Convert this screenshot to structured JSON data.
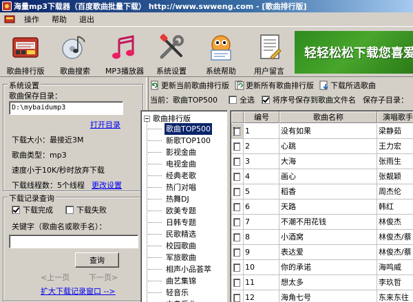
{
  "window": {
    "title": "海量mp3下载器（百度歌曲批量下载） http://www.swweng.com - [歌曲排行版]"
  },
  "menu": {
    "items": [
      "操作",
      "帮助",
      "退出"
    ]
  },
  "toolbar": {
    "buttons": [
      {
        "label": "歌曲排行版",
        "icon": "ranking-icon"
      },
      {
        "label": "歌曲搜索",
        "icon": "music-search-icon"
      },
      {
        "label": "MP3播放器",
        "icon": "music-notes-icon"
      },
      {
        "label": "系统设置",
        "icon": "tools-icon"
      },
      {
        "label": "系统帮助",
        "icon": "help-mascot-icon"
      },
      {
        "label": "用户留言",
        "icon": "document-icon"
      }
    ],
    "banner": "轻轻松松下载您喜爱"
  },
  "settings": {
    "legend": "系统设置",
    "save_dir_label": "歌曲保存目录：",
    "save_dir_value": "D:\\mybaidump3",
    "open_dir_link": "打开目录",
    "size_label": "下载大小：最接近3M",
    "type_label": "歌曲类型：mp3",
    "speed_label": "速度小于10K/秒时放弃下载",
    "threads_label": "下载线程数：5个线程",
    "change_settings_link": "更改设置"
  },
  "history": {
    "legend": "下载记录查询",
    "success_label": "下载完成",
    "success_checked": true,
    "failed_label": "下载失败",
    "failed_checked": false,
    "keyword_label": "关键字（歌曲名或歌手名）：",
    "keyword_value": "",
    "query_button": "查询",
    "prev_link": "<上一页",
    "next_link": "下一页>",
    "expand_link": "扩大下载记录窗口 -->"
  },
  "actions": {
    "update_current": "更新当前歌曲排行版",
    "update_all": "更新所有歌曲排行版",
    "download_selected": "下载所选歌曲"
  },
  "options": {
    "current_label": "当前：歌曲TOP500",
    "select_all_label": "全选",
    "select_all_checked": false,
    "save_by_index_label": "将序号保存到歌曲文件名",
    "save_by_index_checked": true,
    "save_subdir_label": "保存子目录："
  },
  "tree": {
    "root": "歌曲排行版",
    "selected_index": 0,
    "nodes": [
      "歌曲TOP500",
      "新歌TOP100",
      "影视金曲",
      "电视金曲",
      "经典老歌",
      "热门对唱",
      "热舞DJ",
      "欧美专题",
      "日韩专题",
      "民歌精选",
      "校园歌曲",
      "军旅歌曲",
      "相声小品荟萃",
      "曲艺集锦",
      "轻音乐",
      "古典乐曲"
    ]
  },
  "table": {
    "columns": [
      "",
      "编号",
      "歌曲名称",
      "演唱歌手"
    ],
    "rows": [
      {
        "num": "1",
        "song": "没有如果",
        "artist": "梁静茹",
        "checked": false
      },
      {
        "num": "2",
        "song": "心跳",
        "artist": "王力宏",
        "checked": false
      },
      {
        "num": "3",
        "song": "大海",
        "artist": "张雨生",
        "checked": false
      },
      {
        "num": "4",
        "song": "画心",
        "artist": "张靓颖",
        "checked": false
      },
      {
        "num": "5",
        "song": "稻香",
        "artist": "周杰伦",
        "checked": false
      },
      {
        "num": "6",
        "song": "天路",
        "artist": "韩红",
        "checked": false
      },
      {
        "num": "7",
        "song": "不潮不用花钱",
        "artist": "林俊杰",
        "checked": false
      },
      {
        "num": "8",
        "song": "小酒窝",
        "artist": "林俊杰/蔡",
        "checked": false
      },
      {
        "num": "9",
        "song": "表达爱",
        "artist": "林俊杰/蔡",
        "checked": false
      },
      {
        "num": "10",
        "song": "你的承诺",
        "artist": "海鸣威",
        "checked": false
      },
      {
        "num": "11",
        "song": "想太多",
        "artist": "李玖哲",
        "checked": false
      },
      {
        "num": "12",
        "song": "海角七号",
        "artist": "东来东往",
        "checked": false
      }
    ]
  },
  "colors": {
    "title_bar": "#0a246a",
    "selection": "#0a246a",
    "banner": "#2e8b1e",
    "face": "#d4d0c8"
  }
}
